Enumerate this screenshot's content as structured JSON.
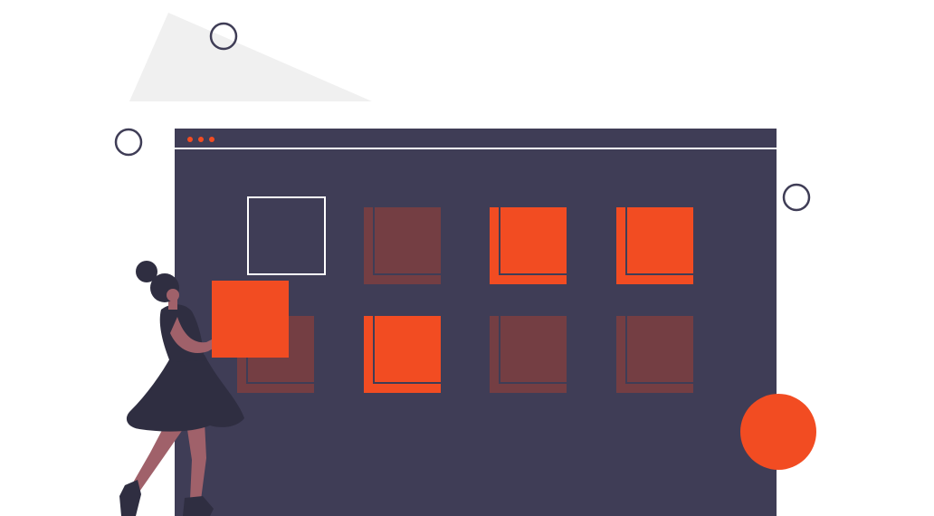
{
  "colors": {
    "background": "#ffffff",
    "window": "#3f3d56",
    "titlebar_line": "#ffffff",
    "accent": "#f24c22",
    "tile_muted": "#743e43",
    "triangle": "#f0f0f0",
    "ring": "#3f3d56",
    "skin": "#a0616a",
    "hair_dress": "#2f2e41",
    "shoe": "#2f2e41"
  },
  "window": {
    "titlebar_dots": 3
  },
  "tiles": [
    {
      "name": "tile-empty-outline",
      "state": "empty"
    },
    {
      "name": "tile-muted-1",
      "state": "muted"
    },
    {
      "name": "tile-filled-1",
      "state": "filled"
    },
    {
      "name": "tile-filled-2",
      "state": "filled"
    },
    {
      "name": "tile-muted-2",
      "state": "muted"
    },
    {
      "name": "tile-filled-3",
      "state": "filled"
    },
    {
      "name": "tile-muted-3",
      "state": "muted"
    },
    {
      "name": "tile-muted-4",
      "state": "muted"
    }
  ],
  "held_tile": {
    "state": "filled"
  }
}
